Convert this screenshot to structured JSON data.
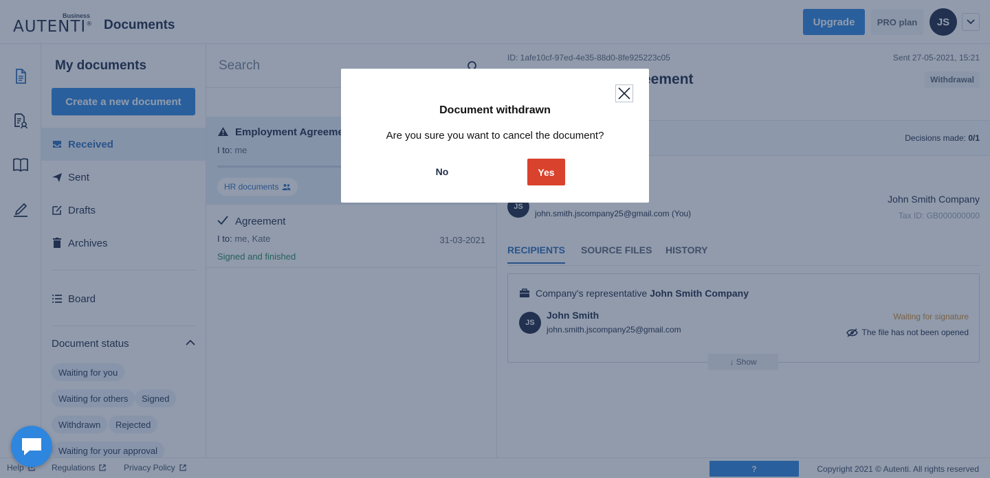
{
  "header": {
    "logo_business": "Business",
    "logo_word": "AUTENTI",
    "logo_mark": "®",
    "app_title": "Documents",
    "upgrade_label": "Upgrade",
    "plan_label": "PRO plan",
    "avatar_initials": "JS"
  },
  "sidebar": {
    "title": "My documents",
    "create_label": "Create a new document",
    "nav": [
      {
        "label": "Received",
        "icon": "inbox-icon",
        "active": true
      },
      {
        "label": "Sent",
        "icon": "paper-plane-icon"
      },
      {
        "label": "Drafts",
        "icon": "edit-icon"
      },
      {
        "label": "Archives",
        "icon": "trash-icon"
      }
    ],
    "board_label": "Board",
    "status_heading": "Document status",
    "status_chips": [
      "Waiting for you",
      "Waiting for others",
      "Signed",
      "Withdrawn",
      "Rejected",
      "Waiting for your approval"
    ]
  },
  "list": {
    "search_placeholder": "Search",
    "docs": [
      {
        "title": "Employment Agreement",
        "to_label": "I to:",
        "to_value": "me",
        "tag": "HR documents"
      },
      {
        "title": "Agreement",
        "to_label": "I to:",
        "to_value": "me, Kate",
        "date": "31-03-2021",
        "status": "Signed and finished"
      }
    ]
  },
  "detail": {
    "id": "ID: 1afe10cf-97ed-4e35-88d0-8fe925223c05",
    "sent": "Sent 27-05-2021, 15:21",
    "title_visible": "eement",
    "badge": "Withdrawal",
    "decisions_label": "Decisions made:",
    "decisions_value": "0/1",
    "sender_initials": "JS",
    "sender_email": "john.smith.jscompany25@gmail.com (You)",
    "company_name": "John Smith Company",
    "tax_id": "Tax ID: GB000000000",
    "tabs": [
      "RECIPIENTS",
      "SOURCE FILES",
      "HISTORY"
    ],
    "recipients": {
      "rep_prefix": "Company's representative",
      "rep_company": "John Smith Company",
      "initials": "JS",
      "name": "John Smith",
      "email": "john.smith.jscompany25@gmail.com",
      "status": "Waiting for signature",
      "opened": "The file has not been opened",
      "show_label": "↓ Show"
    }
  },
  "footer": {
    "help": "Help",
    "regulations": "Regulations",
    "privacy": "Privacy Policy",
    "widget": "?",
    "copyright": "Copyright 2021 © Autenti. All rights reserved"
  },
  "modal": {
    "title": "Document withdrawn",
    "body": "Are you sure you want to cancel the document?",
    "no_label": "No",
    "yes_label": "Yes"
  },
  "colors": {
    "primary": "#2e86de",
    "danger": "#d9422d",
    "navy": "#1f2b45",
    "warning_text": "#d08a2c",
    "success_text": "#2a8a5a"
  }
}
